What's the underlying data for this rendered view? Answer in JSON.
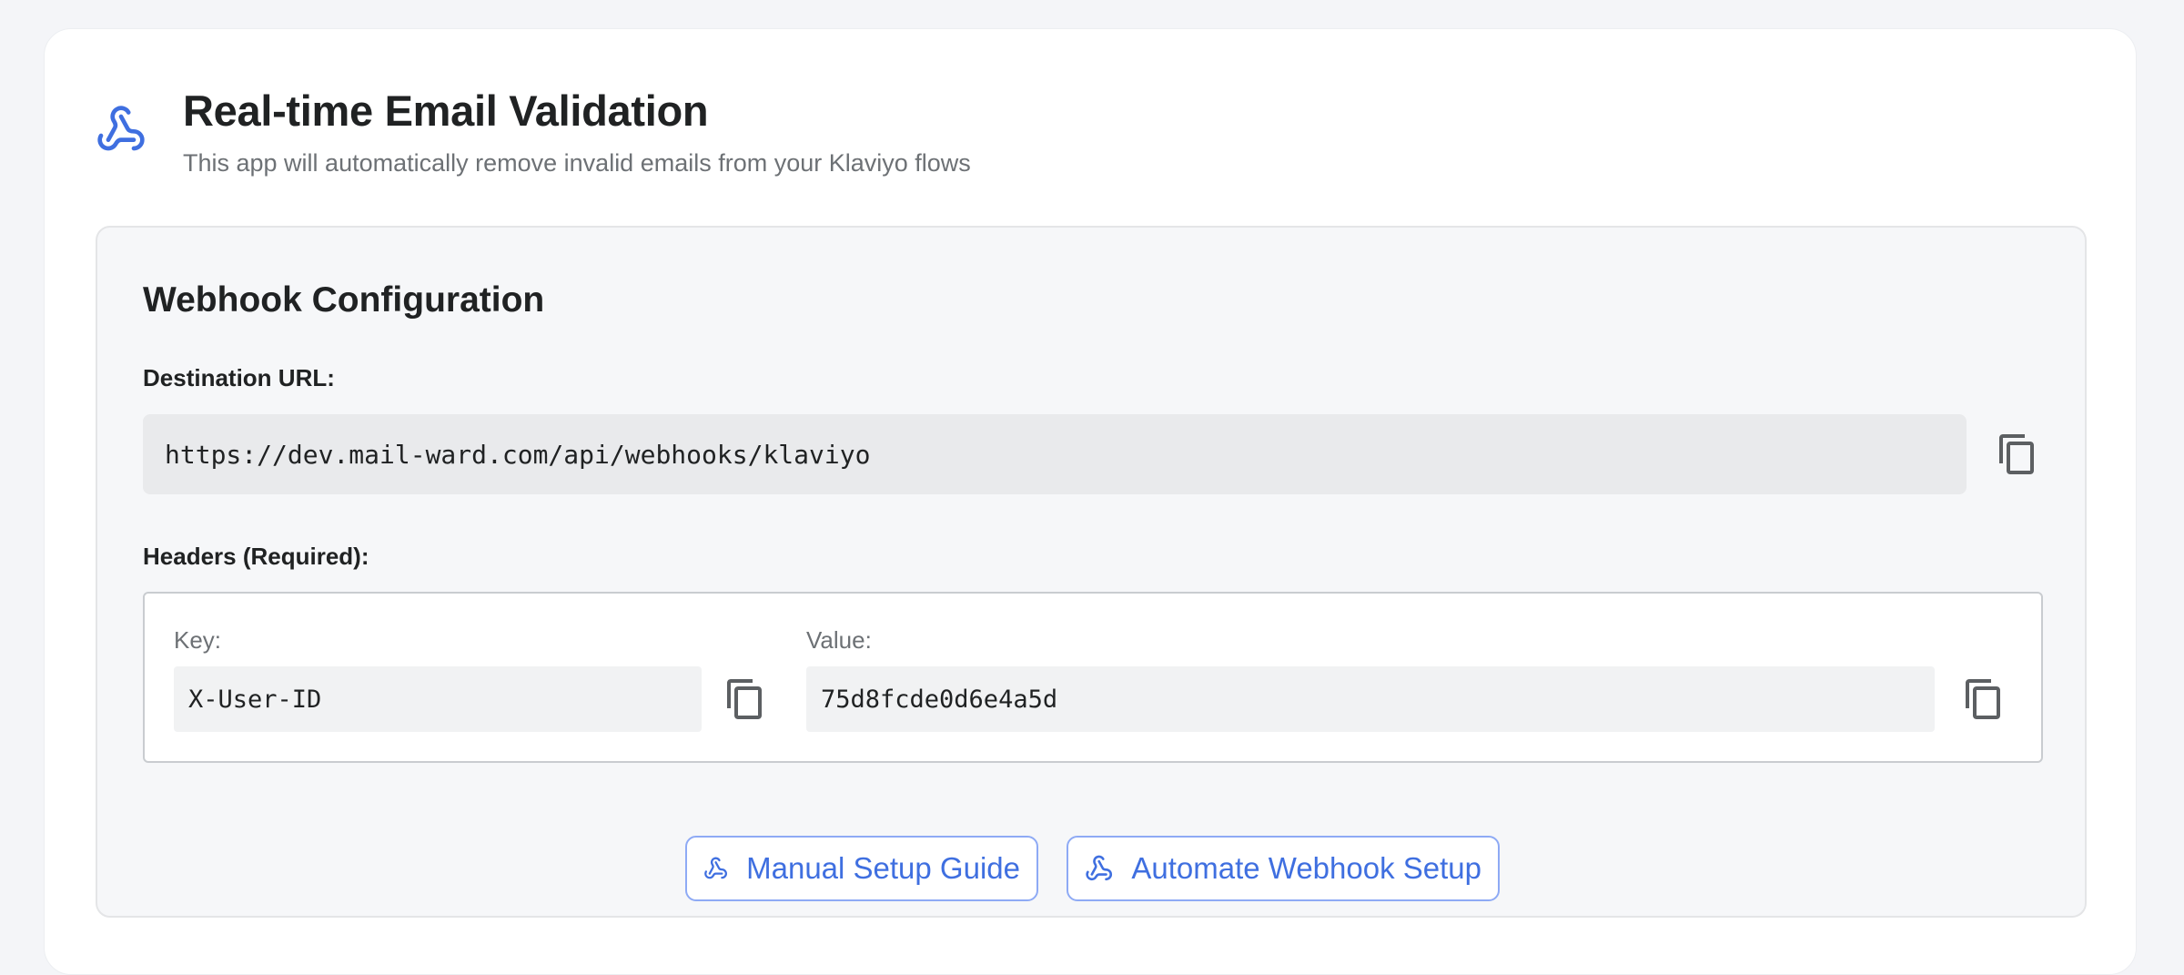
{
  "header": {
    "icon": "webhook-icon",
    "title": "Real-time Email Validation",
    "subtitle": "This app will automatically remove invalid emails from your Klaviyo flows"
  },
  "webhook": {
    "section_title": "Webhook Configuration",
    "destination_label": "Destination URL:",
    "destination_url": "https://dev.mail-ward.com/api/webhooks/klaviyo",
    "headers_label": "Headers (Required):",
    "key_label": "Key:",
    "key_value": "X-User-ID",
    "value_label": "Value:",
    "value_value": "75d8fcde0d6e4a5d",
    "copy_icon": "copy-icon"
  },
  "actions": {
    "manual_label": "Manual Setup Guide",
    "automate_label": "Automate Webhook Setup",
    "icon": "webhook-icon"
  },
  "colors": {
    "accent": "#3f6fe0",
    "accent_border": "#8eaaf5",
    "page_bg": "#f4f5f8",
    "section_bg": "#f6f7f9"
  }
}
